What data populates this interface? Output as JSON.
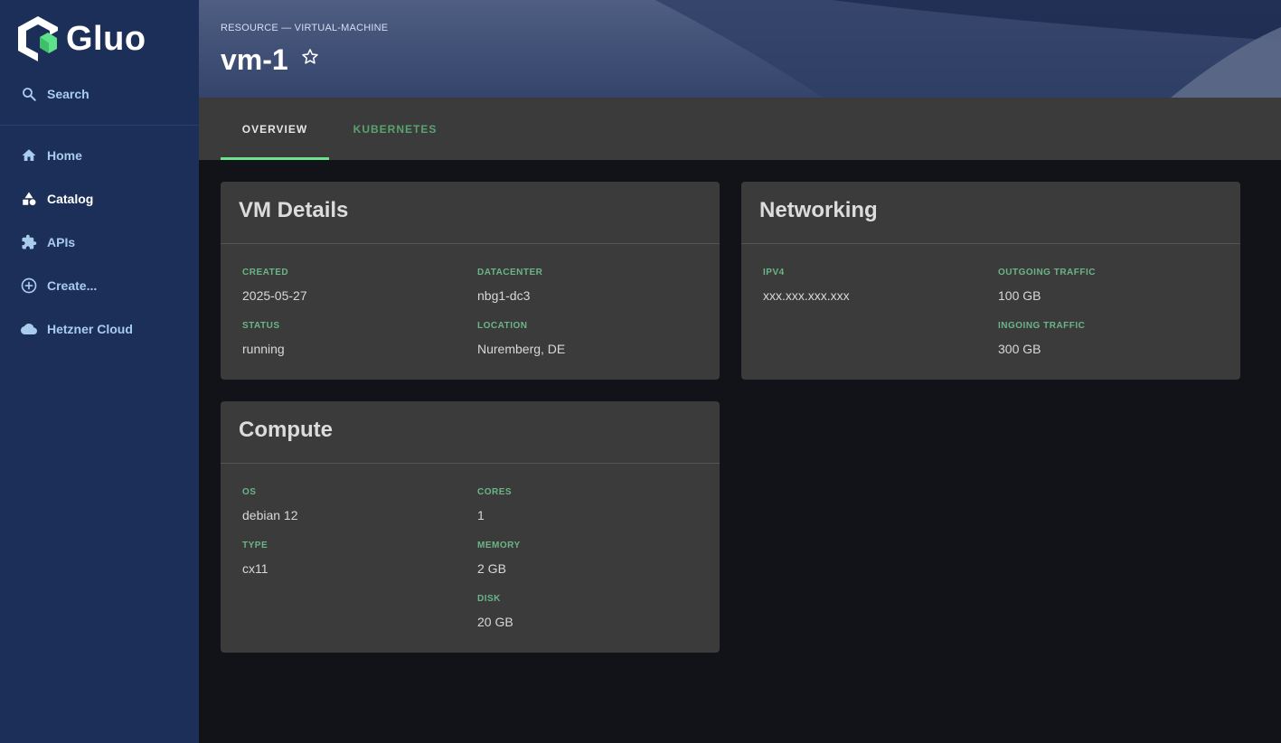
{
  "app": {
    "name": "Gluo"
  },
  "sidebar": {
    "search_label": "Search",
    "items": [
      {
        "label": "Home",
        "icon": "home-icon"
      },
      {
        "label": "Catalog",
        "icon": "catalog-icon"
      },
      {
        "label": "APIs",
        "icon": "puzzle-icon"
      },
      {
        "label": "Create...",
        "icon": "add-circle-icon"
      },
      {
        "label": "Hetzner Cloud",
        "icon": "cloud-icon"
      }
    ]
  },
  "header": {
    "breadcrumb": "RESOURCE — VIRTUAL-MACHINE",
    "title": "vm-1"
  },
  "tabs": [
    {
      "label": "OVERVIEW"
    },
    {
      "label": "KUBERNETES"
    }
  ],
  "vm_details": {
    "title": "VM Details",
    "created_label": "CREATED",
    "created": "2025-05-27",
    "datacenter_label": "DATACENTER",
    "datacenter": "nbg1-dc3",
    "status_label": "STATUS",
    "status": "running",
    "location_label": "LOCATION",
    "location": "Nuremberg, DE"
  },
  "networking": {
    "title": "Networking",
    "ipv4_label": "IPV4",
    "ipv4": "xxx.xxx.xxx.xxx",
    "outgoing_label": "OUTGOING TRAFFIC",
    "outgoing": "100 GB",
    "ingoing_label": "INGOING TRAFFIC",
    "ingoing": "300 GB"
  },
  "compute": {
    "title": "Compute",
    "os_label": "OS",
    "os": "debian 12",
    "cores_label": "CORES",
    "cores": "1",
    "type_label": "TYPE",
    "type": "cx11",
    "memory_label": "MEMORY",
    "memory": "2 GB",
    "disk_label": "DISK",
    "disk": "20 GB"
  },
  "colors": {
    "sidebar_bg": "#1c2f58",
    "accent_green": "#6be38a",
    "label_green": "#6bb487",
    "card_bg": "#3b3b3b",
    "page_bg": "#121219"
  }
}
